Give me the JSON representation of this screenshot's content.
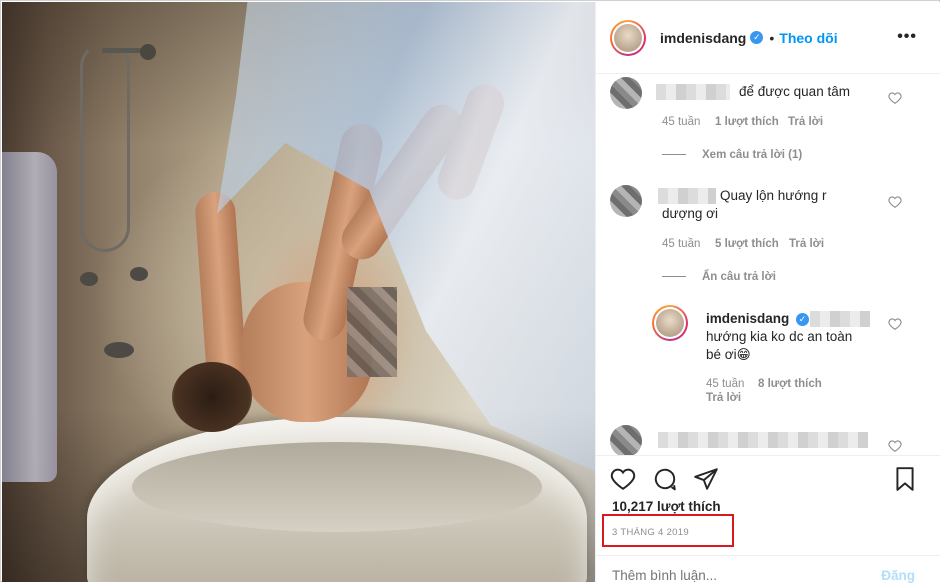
{
  "header": {
    "username": "imdenisdang",
    "separator": "•",
    "follow_label": "Theo dõi",
    "more_label": "•••"
  },
  "comments": [
    {
      "text": "để được quan tâm",
      "age": "45 tuần",
      "likes": "1 lượt thích",
      "reply": "Trả lời",
      "view_replies": "Xem câu trả lời (1)"
    },
    {
      "text_line1": "Quay lộn hướng r",
      "text_line2": "dượng ơi",
      "age": "45 tuần",
      "likes": "5 lượt thích",
      "reply": "Trả lời",
      "hide_replies": "Ẩn câu trả lời"
    },
    {
      "username": "imdenisdang",
      "text_line1": "hướng kia ko dc an toàn",
      "text_line2": "bé ơi😁",
      "age": "45 tuần",
      "likes": "8 lượt thích",
      "reply": "Trả lời"
    }
  ],
  "actions": {
    "likes_count": "10,217 lượt thích",
    "date": "3 THÁNG 4 2019",
    "comment_placeholder": "Thêm bình luận...",
    "post_label": "Đăng"
  },
  "colors": {
    "accent": "#0095f6",
    "highlight_box": "#d71920",
    "muted": "#8e8e8e"
  }
}
